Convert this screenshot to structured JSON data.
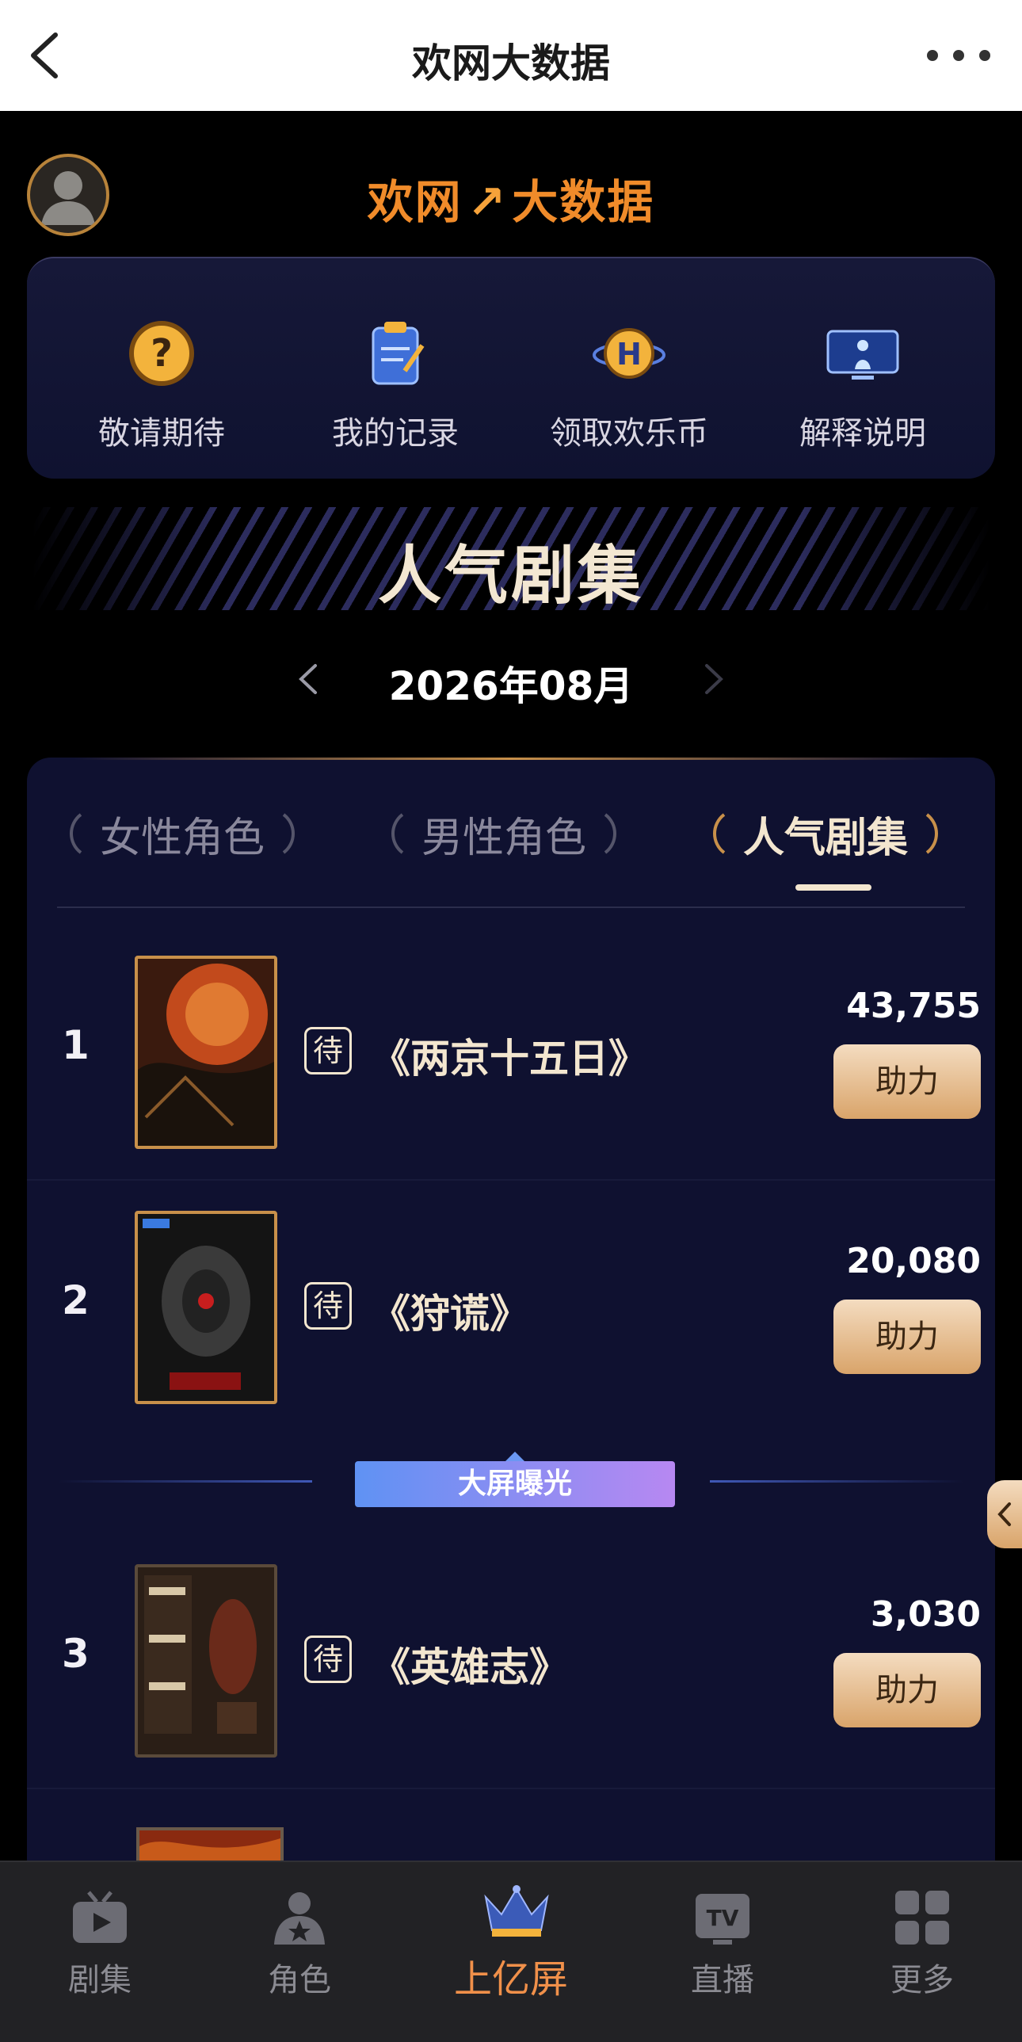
{
  "topbar": {
    "title": "欢网大数据"
  },
  "header": {
    "brand_left": "欢网",
    "brand_right": "大数据"
  },
  "quick_actions": [
    {
      "label": "敬请期待",
      "icon": "question-icon"
    },
    {
      "label": "我的记录",
      "icon": "clipboard-icon"
    },
    {
      "label": "领取欢乐币",
      "icon": "coin-icon"
    },
    {
      "label": "解释说明",
      "icon": "tv-screen-icon"
    }
  ],
  "section": {
    "title": "人气剧集",
    "month": "2026年08月"
  },
  "tabs": [
    {
      "label": "女性角色",
      "active": false
    },
    {
      "label": "男性角色",
      "active": false
    },
    {
      "label": "人气剧集",
      "active": true
    }
  ],
  "list": [
    {
      "rank": "1",
      "badge": "待",
      "name": "《两京十五日》",
      "score": "43,755",
      "action": "助力"
    },
    {
      "rank": "2",
      "badge": "待",
      "name": "《狩谎》",
      "score": "20,080",
      "action": "助力"
    },
    {
      "rank": "3",
      "badge": "待",
      "name": "《英雄志》",
      "score": "3,030",
      "action": "助力"
    }
  ],
  "divider": {
    "label": "大屏曝光"
  },
  "bottom_nav": [
    {
      "label": "剧集",
      "icon": "tv-icon",
      "active": false
    },
    {
      "label": "角色",
      "icon": "person-star-icon",
      "active": false
    },
    {
      "label": "上亿屏",
      "icon": "crown-icon",
      "active": true
    },
    {
      "label": "直播",
      "icon": "tv-live-icon",
      "active": false
    },
    {
      "label": "更多",
      "icon": "grid-icon",
      "active": false
    }
  ],
  "colors": {
    "accent": "#f0904a",
    "panel": "#0f1130",
    "gold": "#c8904a",
    "cream": "#f3e6cf"
  }
}
